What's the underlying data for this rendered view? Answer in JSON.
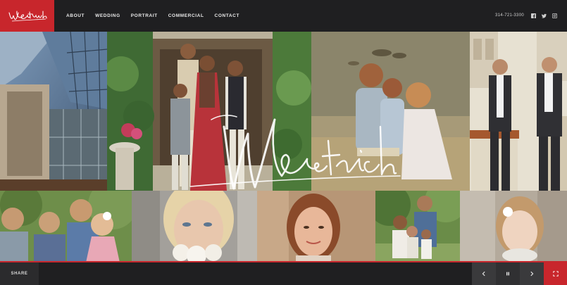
{
  "brand": {
    "logo_text": "Westrich",
    "accent_color": "#c8262c"
  },
  "nav": {
    "items": [
      {
        "label": "ABOUT"
      },
      {
        "label": "WEDDING"
      },
      {
        "label": "PORTRAIT"
      },
      {
        "label": "COMMERCIAL"
      },
      {
        "label": "CONTACT"
      }
    ]
  },
  "header": {
    "phone": "314-721-3300",
    "social_icons": [
      "facebook-icon",
      "twitter-icon",
      "instagram-icon"
    ]
  },
  "hero": {
    "watermark_text": "Westrich"
  },
  "footer": {
    "share_label": "SHARE",
    "controls": [
      "chevron-left-icon",
      "pause-icon",
      "chevron-right-icon",
      "fullscreen-icon"
    ]
  }
}
